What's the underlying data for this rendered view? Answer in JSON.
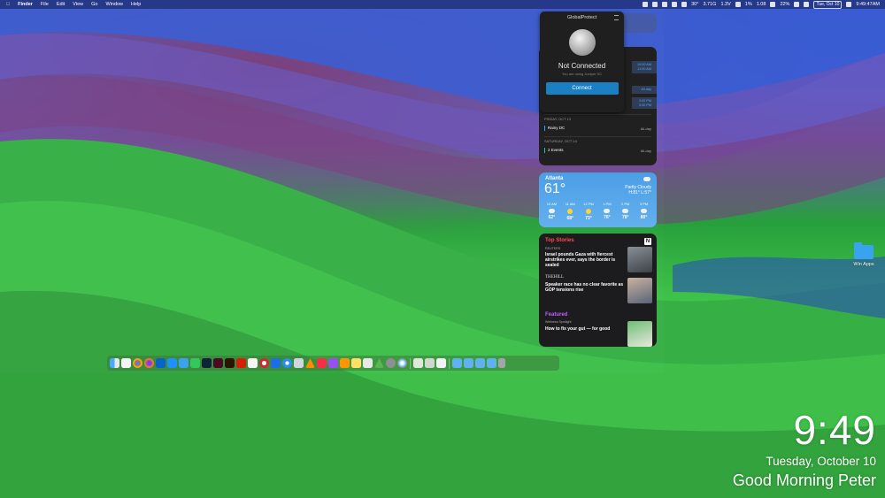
{
  "menubar": {
    "items": [
      "Finder",
      "File",
      "Edit",
      "View",
      "Go",
      "Window",
      "Help"
    ],
    "status_items": [
      "30°",
      "3.71G",
      "1.3V",
      "1%",
      "1.08",
      "22%"
    ],
    "date_badge": "Tue, Oct 10",
    "time": "9:49:47AM"
  },
  "globalprotect": {
    "title": "GlobalProtect",
    "status": "Not Connected",
    "subtitle": "You are using Juniper SC",
    "connect_label": "Connect"
  },
  "calendar": {
    "top_events": [
      {
        "time": "10:00 AM\n11:00 AM"
      },
      {
        "time": "All-day"
      },
      {
        "time": "3:00 PM\n3:30 PM"
      }
    ],
    "day1_header": "FRIDAY, OCT 13",
    "day1_event": "Rainy DC",
    "day1_event_time": "All-day",
    "day2_header": "SATURDAY, OCT 14",
    "day2_event": "2 Events",
    "day2_event_time": "All-day"
  },
  "weather": {
    "city": "Atlanta",
    "temp": "61°",
    "condition": "Partly Cloudy",
    "hilo": "H:81° L:57°",
    "hours": [
      {
        "time": "10 AM",
        "temp": "62°",
        "icon": "cloud-sun-icon"
      },
      {
        "time": "11 AM",
        "temp": "68°",
        "icon": "sun-icon"
      },
      {
        "time": "12 PM",
        "temp": "73°",
        "icon": "sun-icon"
      },
      {
        "time": "1 PM",
        "temp": "76°",
        "icon": "cloud-sun-icon"
      },
      {
        "time": "2 PM",
        "temp": "78°",
        "icon": "cloud-icon"
      },
      {
        "time": "3 PM",
        "temp": "80°",
        "icon": "cloud-icon"
      }
    ]
  },
  "news": {
    "top_label": "Top Stories",
    "source1": "REUTERS",
    "headline1": "Israel pounds Gaza with fiercest airstrikes ever, says the border is sealed",
    "source2": "THEHILL",
    "headline2": "Speaker race has no clear favorite as GOP tensions rise",
    "featured_label": "Featured",
    "featured_source": "Wellness Spotlight",
    "featured_headline": "How to fix your gut — for good"
  },
  "desktop": {
    "folder_label": "Win Apps"
  },
  "lockclock": {
    "time": "9:49",
    "date": "Tuesday, October 10",
    "greeting": "Good Morning Peter"
  },
  "colors": {
    "accent_blue": "#1b7fc4",
    "news_red": "#ff4a4a",
    "news_purple": "#c35cff",
    "calendar_blue": "#52a7ff"
  },
  "dock_apps": [
    "finder-icon",
    "calendar-icon",
    "chrome-icon",
    "firefox-icon",
    "outlook-icon",
    "app-store-icon",
    "mail-icon",
    "messages-icon",
    "photoshop-icon",
    "indesign-icon",
    "illustrator-icon",
    "acrobat-icon",
    "news-icon",
    "opera-icon",
    "1password-icon",
    "safari-icon",
    "screen-icon",
    "vlc-icon",
    "music-icon",
    "podcasts-icon",
    "books-icon",
    "notes-icon",
    "files-icon",
    "steam-icon",
    "system-settings-icon",
    "photos-icon",
    "preview-icon",
    "scripts-icon",
    "folder-icon",
    "folder-icon",
    "folder-icon",
    "folder-icon",
    "trash-icon"
  ]
}
